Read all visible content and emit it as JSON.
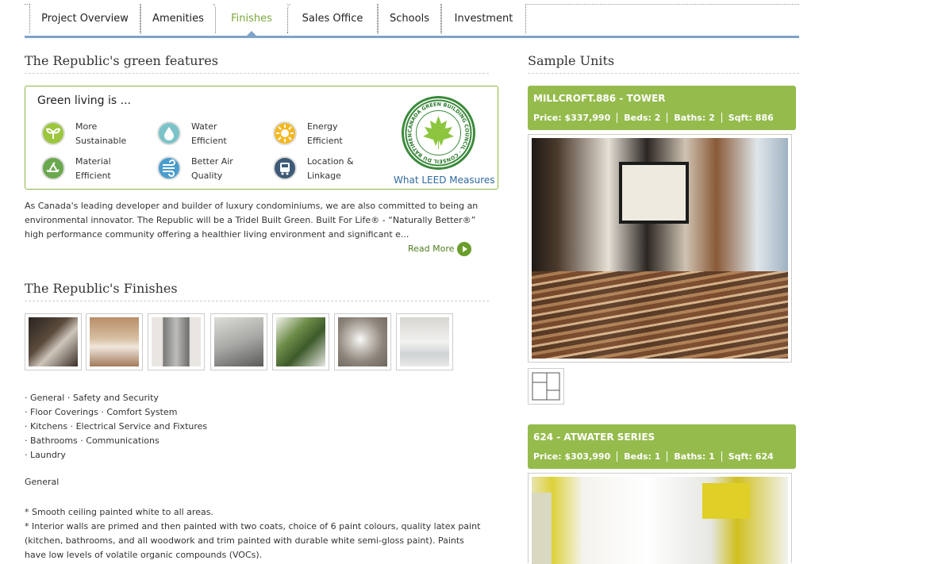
{
  "tabs": [
    "Project Overview",
    "Amenities",
    "Finishes",
    "Sales Office",
    "Schools",
    "Investment"
  ],
  "active_tab": "Finishes",
  "green": {
    "section_title": "The Republic's green features",
    "heading": "Green living is ...",
    "features": [
      {
        "label": "More\nSustainable",
        "icon": "leaf-sprout-icon",
        "color": "#9bc63d"
      },
      {
        "label": "Water\nEfficient",
        "icon": "water-drop-icon",
        "color": "#7cc3c9"
      },
      {
        "label": "Energy\nEfficient",
        "icon": "sun-icon",
        "color": "#f5b820"
      },
      {
        "label": "Material\nEfficient",
        "icon": "recycle-icon",
        "color": "#6aa84f"
      },
      {
        "label": "Better Air\nQuality",
        "icon": "air-flow-icon",
        "color": "#4a9dcc"
      },
      {
        "label": "Location &\nLinkage",
        "icon": "bus-icon",
        "color": "#3e5a78"
      }
    ],
    "seal_text": "CANADA GREEN BUILDING COUNCIL · CONSEIL DU BÂTIMENT DURABLE DU CANADA",
    "leed_link": "What LEED Measures",
    "paragraph": "As Canada's leading developer and builder of luxury condominiums, we are also committed to being an environmental innovator. The Republic will be a Tridel Built Green. Built For Life® - “Naturally Better®” high performance community offering a healthier living environment and significant e...",
    "read_more": "Read More"
  },
  "finishes": {
    "section_title": "The Republic's Finishes",
    "thumbnails": [
      "kitchen-photo",
      "faucet-photo",
      "fridge-photo",
      "sink-photo",
      "window-photo",
      "shower-photo",
      "washer-photo"
    ],
    "categories": [
      [
        "General",
        "Safety and Security"
      ],
      [
        "Floor Coverings",
        "Comfort System"
      ],
      [
        "Kitchens",
        "Electrical Service and Fixtures"
      ],
      [
        "Bathrooms",
        "Communications"
      ],
      [
        "Laundry"
      ]
    ],
    "selected_heading": "General",
    "details": [
      "* Smooth ceiling painted white to all areas.",
      "* Interior walls are primed and then painted with two coats, choice of 6 paint colours, quality latex paint (kitchen, bathrooms, and all woodwork and trim painted with durable white semi-gloss paint). Paints have low levels of volatile organic compounds (VOCs)."
    ]
  },
  "sample": {
    "section_title": "Sample Units",
    "units": [
      {
        "name": "MILLCROFT.886 - TOWER",
        "price": "Price: $337,990",
        "beds": "Beds: 2",
        "baths": "Baths: 2",
        "sqft": "Sqft: 886"
      },
      {
        "name": "624 - ATWATER SERIES",
        "price": "Price: $303,990",
        "beds": "Beds: 1",
        "baths": "Baths: 1",
        "sqft": "Sqft: 624"
      }
    ]
  },
  "colors": {
    "accent_green": "#95bb4d",
    "tab_line": "#7ea3c8",
    "link_blue": "#2f6aa0"
  }
}
